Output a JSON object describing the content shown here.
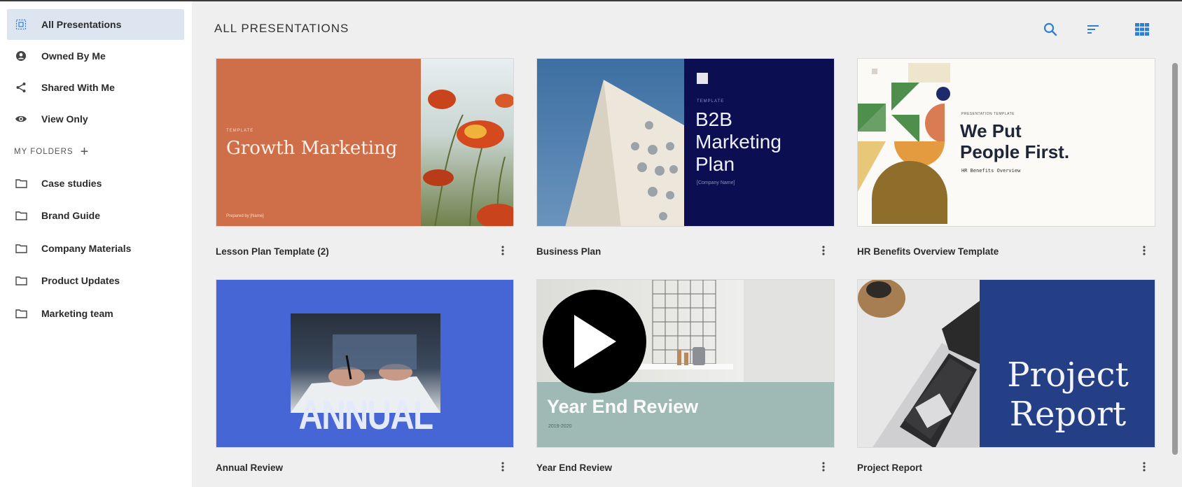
{
  "sidebar": {
    "items": [
      {
        "label": "All Presentations",
        "icon": "all-presentations-icon",
        "active": true
      },
      {
        "label": "Owned By Me",
        "icon": "user-circle-icon"
      },
      {
        "label": "Shared With Me",
        "icon": "share-icon"
      },
      {
        "label": "View Only",
        "icon": "eye-icon"
      }
    ],
    "folders_heading": "MY FOLDERS",
    "folders": [
      {
        "label": "Case studies",
        "icon": "folder-icon"
      },
      {
        "label": "Brand Guide",
        "icon": "folder-icon"
      },
      {
        "label": "Company Materials",
        "icon": "folder-icon"
      },
      {
        "label": "Product Updates",
        "icon": "folder-icon"
      },
      {
        "label": "Marketing team",
        "icon": "folder-icon"
      }
    ]
  },
  "main": {
    "title": "ALL PRESENTATIONS",
    "toolbar_icons": [
      "search-icon",
      "sort-icon",
      "grid-view-icon"
    ],
    "accent": "#2f7fd8",
    "cards": [
      {
        "title": "Lesson Plan Template (2)",
        "thumb": {
          "kicker": "TEMPLATE",
          "headline": "Growth Marketing",
          "footer": "Prepared by [Name]",
          "bg": "#cf6f4a"
        }
      },
      {
        "title": "Business Plan",
        "thumb": {
          "kicker": "TEMPLATE",
          "headline_lines": [
            "B2B",
            "Marketing",
            "Plan"
          ],
          "footer": "[Company Name]",
          "bg": "#0b0f52"
        }
      },
      {
        "title": "HR Benefits Overview Template",
        "thumb": {
          "kicker": "PRESENTATION TEMPLATE",
          "headline_lines": [
            "We Put",
            "People First."
          ],
          "sub": "HR Benefits Overview"
        }
      },
      {
        "title": "Annual Review",
        "thumb": {
          "headline": "ANNUAL REVIEW",
          "bg": "#4666d6"
        }
      },
      {
        "title": "Year End Review",
        "thumb": {
          "headline": "Year End Review",
          "sub": "2019-2020",
          "bg": "#9fbab4"
        }
      },
      {
        "title": "Project Report",
        "thumb": {
          "headline_lines": [
            "Project",
            "Report"
          ],
          "bg": "#253f86"
        }
      }
    ]
  }
}
